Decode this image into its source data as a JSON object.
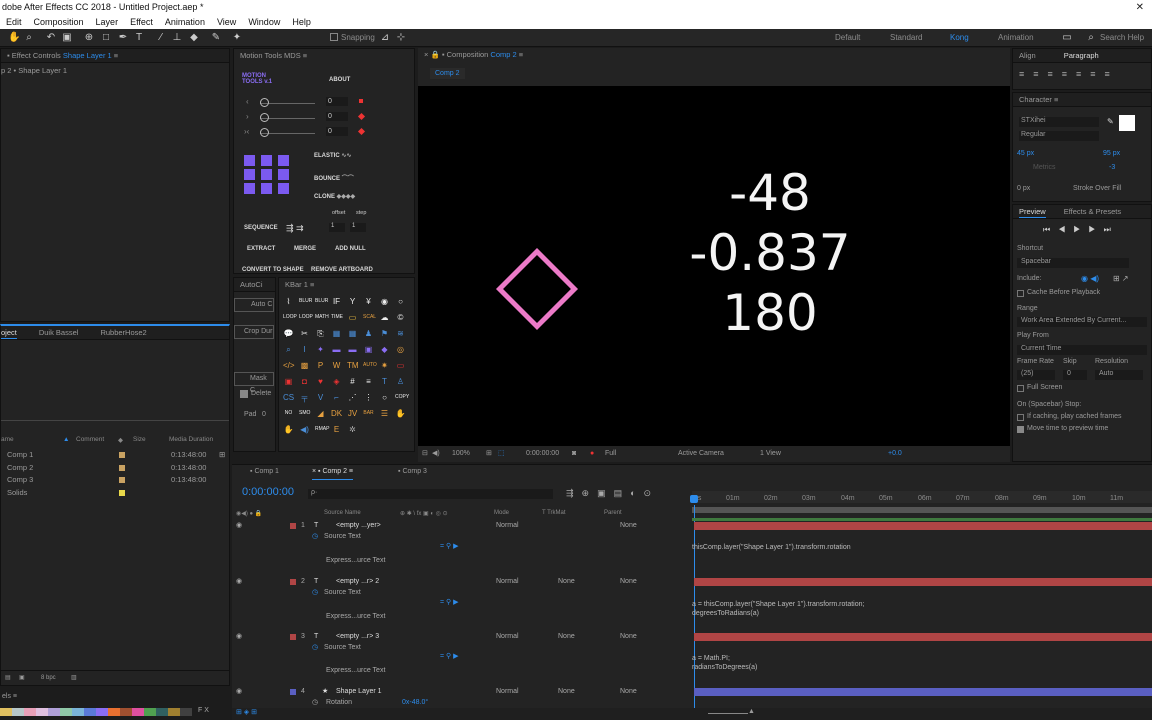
{
  "window": {
    "title": "dobe After Effects CC 2018 - Untitled Project.aep *"
  },
  "menu": [
    "Edit",
    "Composition",
    "Layer",
    "Effect",
    "Animation",
    "View",
    "Window",
    "Help"
  ],
  "toolbar": {
    "snapping": "Snapping",
    "workspaces": [
      "Default",
      "Standard",
      "Kong",
      "Animation"
    ],
    "search": "Search Help"
  },
  "effect_controls": {
    "tab": "Effect Controls",
    "layer": "Shape Layer 1",
    "crumb": "p 2 • Shape Layer 1"
  },
  "motion_tools": {
    "tab": "Motion Tools MDS",
    "logo1": "MOTION",
    "logo2": "TOOLS v.1",
    "about": "ABOUT",
    "sliders": [
      {
        "sym": "‹",
        "val": "0"
      },
      {
        "sym": "›",
        "val": "0"
      },
      {
        "sym": "›‹",
        "val": "0"
      }
    ],
    "elastic": "ELASTIC",
    "bounce": "BOUNCE",
    "clone": "CLONE",
    "offset": "offset",
    "step": "step",
    "sequence": "SEQUENCE",
    "seq1": "1",
    "seq2": "1",
    "extract": "EXTRACT",
    "merge": "MERGE",
    "add_null": "ADD NULL",
    "convert": "CONVERT TO SHAPE",
    "remove": "REMOVE ARTBOARD"
  },
  "autoc": {
    "tab": "AutoCi",
    "b1": "Auto C",
    "b2": "Crop Dur",
    "b3": "Mask C",
    "delete": "Delete",
    "pad": "Pad",
    "padval": "0"
  },
  "kbar": {
    "tab": "KBar 1"
  },
  "project": {
    "tabs": [
      "oject",
      "Duik Bassel",
      "RubberHose2"
    ],
    "col_name": "ame",
    "col_comment": "Comment",
    "col_size": "Size",
    "col_dur": "Media Duration",
    "items": [
      {
        "name": "Comp 1",
        "dur": "0:13:48:00"
      },
      {
        "name": "Comp 2",
        "dur": "0:13:48:00"
      },
      {
        "name": "Comp 3",
        "dur": "0:13:48:00"
      },
      {
        "name": "Solids",
        "dur": ""
      }
    ],
    "bpc": "8 bpc"
  },
  "composition": {
    "tab": "Composition",
    "name": "Comp 2",
    "subtab": "Comp 2",
    "values": [
      "-48",
      "-0.837",
      "180"
    ],
    "footer": {
      "zoom": "100%",
      "time": "0:00:00:00",
      "res": "Full",
      "camera": "Active Camera",
      "view": "1 View",
      "offset": "+0.0"
    }
  },
  "right": {
    "align": "Align",
    "paragraph": "Paragraph",
    "character": "Character",
    "font": "STXihei",
    "style": "Regular",
    "size": "45 px",
    "leading": "95 px",
    "tracking": "-3",
    "metrics": "Metrics",
    "stroke_w": "0 px",
    "stroke_mode": "Stroke Over Fill",
    "preview": "Preview",
    "effects": "Effects & Presets",
    "shortcut_l": "Shortcut",
    "shortcut": "Spacebar",
    "include": "Include:",
    "cache": "Cache Before Playback",
    "range_l": "Range",
    "range": "Work Area Extended By Current...",
    "playfrom_l": "Play From",
    "playfrom": "Current Time",
    "fr_l": "Frame Rate",
    "skip_l": "Skip",
    "res_l": "Resolution",
    "fr": "(25)",
    "skip": "0",
    "res": "Auto",
    "fullscreen": "Full Screen",
    "onstop": "On (Spacebar) Stop:",
    "ifcache": "If caching, play cached frames",
    "movetime": "Move time to preview time"
  },
  "timeline": {
    "tabs": [
      "Comp 1",
      "Comp 2",
      "Comp 3"
    ],
    "time": "0:00:00:00",
    "search": "ρ·",
    "cols": {
      "source": "Source Name",
      "mode": "Mode",
      "trk": "T  TrkMat",
      "parent": "Parent"
    },
    "ruler": [
      "0s",
      "01m",
      "02m",
      "03m",
      "04m",
      "05m",
      "06m",
      "07m",
      "08m",
      "09m",
      "10m",
      "11m"
    ],
    "layers": [
      {
        "num": "1",
        "name": "<empty ...yer>",
        "mode": "Normal",
        "trk": "",
        "parent": "None",
        "prop": "Source Text",
        "expr": "Express...urce Text",
        "code1": "thisComp.layer(\"Shape Layer 1\").transform.rotation",
        "code2": ""
      },
      {
        "num": "2",
        "name": "<empty ...r> 2",
        "mode": "Normal",
        "trk": "None",
        "parent": "None",
        "prop": "Source Text",
        "expr": "Express...urce Text",
        "code1": "a = thisComp.layer(\"Shape Layer 1\").transform.rotation;",
        "code2": "degreesToRadians(a)"
      },
      {
        "num": "3",
        "name": "<empty ...r> 3",
        "mode": "Normal",
        "trk": "None",
        "parent": "None",
        "prop": "Source Text",
        "expr": "Express...urce Text",
        "code1": "a = Math.PI;",
        "code2": "radiansToDegrees(a)"
      },
      {
        "num": "4",
        "name": "Shape Layer 1",
        "mode": "Normal",
        "trk": "None",
        "parent": "None",
        "prop": "Rotation",
        "value": "0x-48.0°"
      }
    ]
  },
  "colors": {
    "accent": "#2d8ceb",
    "diamond": "#ec7ac8",
    "purple": "#7b5af0",
    "layer_red": "#b04545",
    "layer_blue": "#5a5fc2"
  }
}
